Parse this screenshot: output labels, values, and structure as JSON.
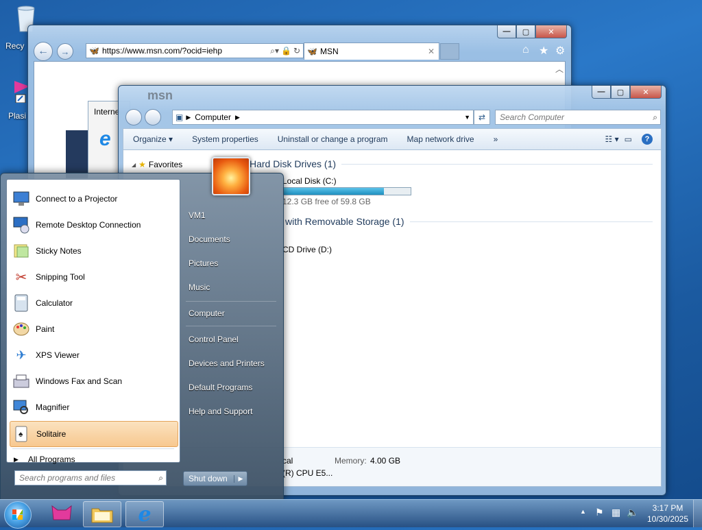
{
  "desktop": {
    "icons": [
      {
        "label": "Recy",
        "icon": "recycle-bin-icon"
      },
      {
        "label": "Plasi",
        "icon": "shortcut-icon"
      }
    ]
  },
  "ie": {
    "url": "https://www.msn.com/?ocid=iehp",
    "tab_title": "MSN",
    "partial_title": "Interne",
    "header_text": "msn"
  },
  "explorer": {
    "breadcrumb": "Computer",
    "search_placeholder": "Search Computer",
    "toolbar": [
      "Organize",
      "System properties",
      "Uninstall or change a program",
      "Map network drive"
    ],
    "overflow": "»",
    "nav": {
      "favorites": "Favorites"
    },
    "groups": {
      "hdd": "Hard Disk Drives (1)",
      "removable": "with Removable Storage (1)"
    },
    "drive_c": {
      "name": "Local Disk (C:)",
      "free": "12.3 GB free of 59.8 GB",
      "used_fraction": 0.79
    },
    "drive_d": {
      "name": "CD Drive (D:)"
    },
    "details": {
      "workgroup_partial": "cal",
      "memory_label": "Memory:",
      "memory_value": "4.00 GB",
      "cpu_partial": "(R) CPU E5..."
    }
  },
  "start_menu": {
    "programs": [
      {
        "label": "Connect to a Projector",
        "icon": "projector-icon"
      },
      {
        "label": "Remote Desktop Connection",
        "icon": "remote-desktop-icon"
      },
      {
        "label": "Sticky Notes",
        "icon": "sticky-notes-icon"
      },
      {
        "label": "Snipping Tool",
        "icon": "scissors-icon"
      },
      {
        "label": "Calculator",
        "icon": "calculator-icon"
      },
      {
        "label": "Paint",
        "icon": "paint-palette-icon"
      },
      {
        "label": "XPS Viewer",
        "icon": "xps-viewer-icon"
      },
      {
        "label": "Windows Fax and Scan",
        "icon": "fax-icon"
      },
      {
        "label": "Magnifier",
        "icon": "magnifier-icon"
      },
      {
        "label": "Solitaire",
        "icon": "cards-icon"
      }
    ],
    "all_programs": "All Programs",
    "search_placeholder": "Search programs and files",
    "right_links": [
      "VM1",
      "Documents",
      "Pictures",
      "Music",
      "Computer",
      "Control Panel",
      "Devices and Printers",
      "Default Programs",
      "Help and Support"
    ],
    "shutdown": "Shut down"
  },
  "taskbar": {
    "time": "3:17 PM",
    "date": "10/30/2025"
  },
  "colors": {
    "accent": "#1e5fa8",
    "highlight": "#f7c88f"
  }
}
